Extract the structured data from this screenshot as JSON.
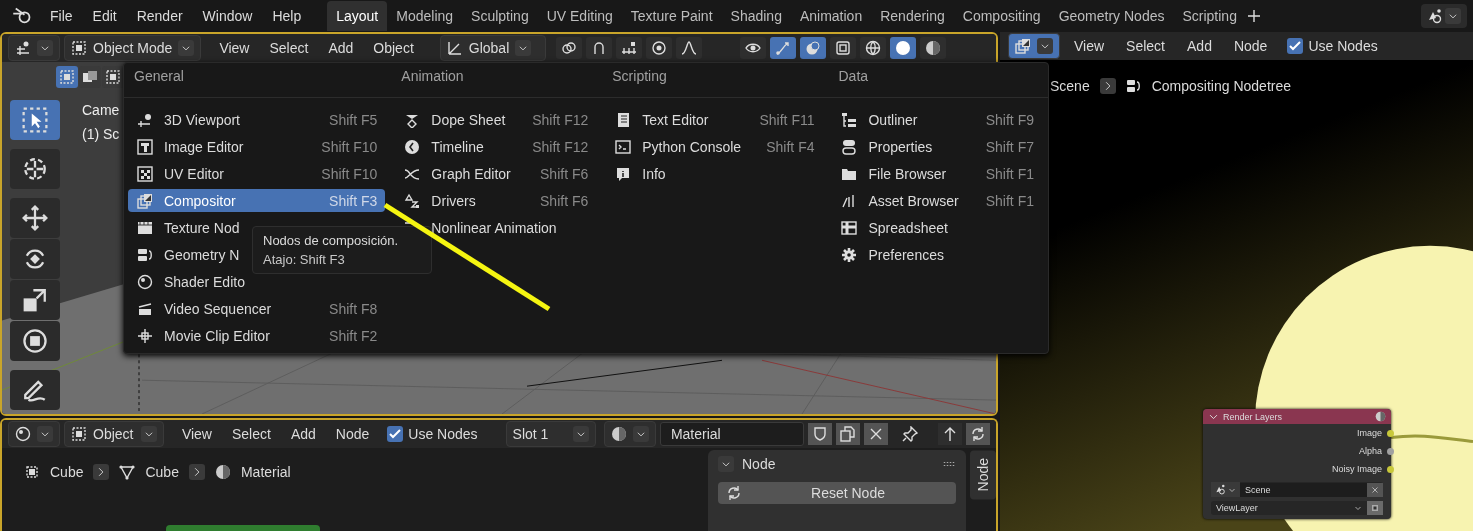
{
  "topbar": {
    "menus": [
      "File",
      "Edit",
      "Render",
      "Window",
      "Help"
    ],
    "workspaces": [
      {
        "label": "Layout",
        "selected": true
      },
      {
        "label": "Modeling",
        "selected": false
      },
      {
        "label": "Sculpting",
        "selected": false
      },
      {
        "label": "UV Editing",
        "selected": false
      },
      {
        "label": "Texture Paint",
        "selected": false
      },
      {
        "label": "Shading",
        "selected": false
      },
      {
        "label": "Animation",
        "selected": false
      },
      {
        "label": "Rendering",
        "selected": false
      },
      {
        "label": "Compositing",
        "selected": false
      },
      {
        "label": "Geometry Nodes",
        "selected": false
      },
      {
        "label": "Scripting",
        "selected": false
      }
    ]
  },
  "viewport": {
    "header": {
      "mode": "Object Mode",
      "menus": [
        "View",
        "Select",
        "Add",
        "Object"
      ],
      "orientation": "Global",
      "toggles": [
        {
          "on": false
        },
        {
          "on": false
        },
        {
          "on": false
        },
        {
          "on": false
        },
        {
          "on": false
        },
        {
          "on": false
        },
        {
          "on": true
        },
        {
          "on": true
        },
        {
          "on": false
        },
        {
          "on": false
        },
        {
          "on": true
        },
        {
          "on": false
        }
      ]
    },
    "select_modes": [
      {
        "selected": true
      },
      {
        "selected": false
      },
      {
        "selected": false
      }
    ],
    "tools": [
      {
        "selected": true
      },
      {
        "selected": false
      },
      {
        "selected": false
      },
      {
        "selected": false
      },
      {
        "selected": false
      },
      {
        "selected": false
      },
      {
        "selected": false
      }
    ],
    "overlay_text": [
      "Came",
      "(1) Sc"
    ]
  },
  "editor_menu": {
    "columns": [
      {
        "title": "General",
        "items": [
          {
            "label": "3D Viewport",
            "shortcut": "Shift F5",
            "selected": false
          },
          {
            "label": "Image Editor",
            "shortcut": "Shift F10",
            "selected": false
          },
          {
            "label": "UV Editor",
            "shortcut": "Shift F10",
            "selected": false
          },
          {
            "label": "Compositor",
            "shortcut": "Shift F3",
            "selected": true
          },
          {
            "label": "Texture Nod",
            "selected": false
          },
          {
            "label": "Geometry N",
            "selected": false
          },
          {
            "label": "Shader Edito",
            "selected": false
          },
          {
            "label": "Video Sequencer",
            "shortcut": "Shift F8",
            "selected": false
          },
          {
            "label": "Movie Clip Editor",
            "shortcut": "Shift F2",
            "selected": false
          }
        ]
      },
      {
        "title": "Animation",
        "items": [
          {
            "label": "Dope Sheet",
            "shortcut": "Shift F12",
            "selected": false
          },
          {
            "label": "Timeline",
            "shortcut": "Shift F12",
            "selected": false
          },
          {
            "label": "Graph Editor",
            "shortcut": "Shift F6",
            "selected": false
          },
          {
            "label": "Drivers",
            "shortcut": "Shift F6",
            "selected": false
          },
          {
            "label": "Nonlinear Animation",
            "selected": false
          }
        ]
      },
      {
        "title": "Scripting",
        "items": [
          {
            "label": "Text Editor",
            "shortcut": "Shift F11",
            "selected": false
          },
          {
            "label": "Python Console",
            "shortcut": "Shift F4",
            "selected": false
          },
          {
            "label": "Info",
            "selected": false
          }
        ]
      },
      {
        "title": "Data",
        "items": [
          {
            "label": "Outliner",
            "shortcut": "Shift F9",
            "selected": false
          },
          {
            "label": "Properties",
            "shortcut": "Shift F7",
            "selected": false
          },
          {
            "label": "File Browser",
            "shortcut": "Shift F1",
            "selected": false
          },
          {
            "label": "Asset Browser",
            "shortcut": "Shift F1",
            "selected": false
          },
          {
            "label": "Spreadsheet",
            "selected": false
          },
          {
            "label": "Preferences",
            "selected": false
          }
        ]
      }
    ]
  },
  "tooltip": {
    "description": "Nodos de composición.",
    "shortcut": "Atajo: Shift F3"
  },
  "shader_editor": {
    "object": "Object",
    "menus": [
      "View",
      "Select",
      "Add",
      "Node"
    ],
    "use_nodes": {
      "label": "Use Nodes",
      "checked": true
    },
    "slot": "Slot 1",
    "material": "Material",
    "breadcrumb": [
      "Cube",
      "Cube",
      "Material"
    ],
    "sidebar": {
      "panel_title": "Node",
      "button": "Reset Node",
      "tab": "Node"
    }
  },
  "compositor": {
    "menus": [
      "View",
      "Select",
      "Add",
      "Node"
    ],
    "use_nodes": {
      "label": "Use Nodes",
      "checked": true
    },
    "breadcrumb": [
      "Scene",
      "Compositing Nodetree"
    ],
    "node": {
      "title": "Render Layers",
      "outputs": [
        {
          "label": "Image",
          "color": "#c8c83a"
        },
        {
          "label": "Alpha",
          "color": "#a0a0a0"
        },
        {
          "label": "Noisy Image",
          "color": "#c8c83a"
        }
      ],
      "scene": "Scene",
      "view_layer": "ViewLayer"
    }
  }
}
